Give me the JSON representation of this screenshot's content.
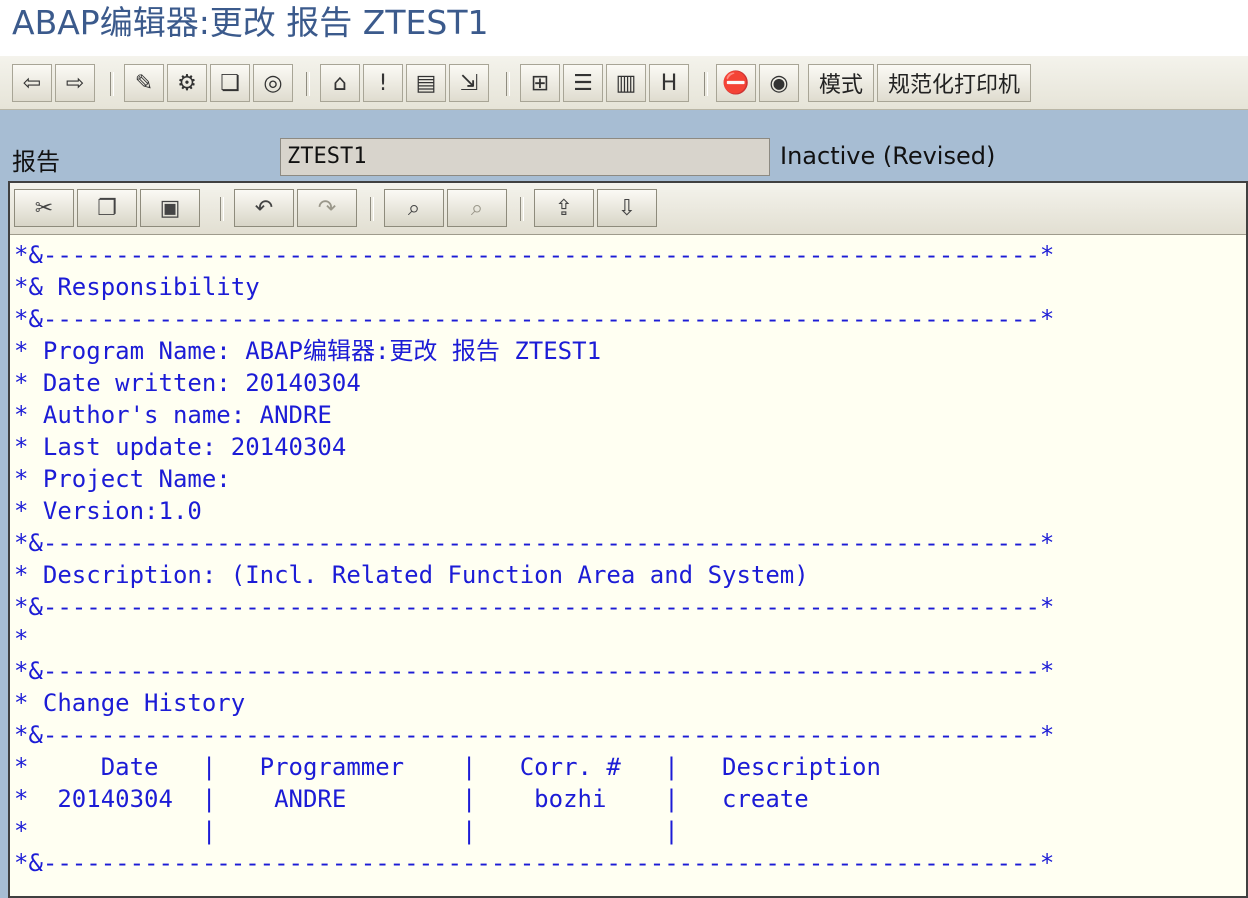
{
  "window": {
    "title": "ABAP编辑器:更改 报告 ZTEST1"
  },
  "toolbar": {
    "nav": [
      {
        "name": "back-icon",
        "glyph": "⇦"
      },
      {
        "name": "forward-icon",
        "glyph": "⇨"
      }
    ],
    "group1": [
      {
        "name": "display-change-icon",
        "glyph": "✎"
      },
      {
        "name": "active-inactive-icon",
        "glyph": "⚙"
      },
      {
        "name": "other-object-icon",
        "glyph": "❏"
      },
      {
        "name": "check-icon",
        "glyph": "◎"
      }
    ],
    "group2": [
      {
        "name": "activate-icon",
        "glyph": "⌂"
      },
      {
        "name": "test-icon",
        "glyph": "!"
      },
      {
        "name": "where-used-icon",
        "glyph": "▤"
      },
      {
        "name": "navigation-icon",
        "glyph": "⇲"
      }
    ],
    "group3": [
      {
        "name": "object-list-icon",
        "glyph": "⊞"
      },
      {
        "name": "stack-icon",
        "glyph": "☰"
      },
      {
        "name": "display-object-icon",
        "glyph": "▥"
      },
      {
        "name": "info-icon",
        "glyph": "H"
      }
    ],
    "group4": [
      {
        "name": "stop-icon",
        "glyph": "⛔"
      },
      {
        "name": "breakpoint-icon",
        "glyph": "◉"
      }
    ],
    "mode_label": "模式",
    "pretty_printer_label": "规范化打印机"
  },
  "report": {
    "label": "报告",
    "name": "ZTEST1",
    "status": "Inactive (Revised)"
  },
  "editor_toolbar": [
    {
      "name": "cut-icon",
      "glyph": "✂",
      "dim": false
    },
    {
      "name": "copy-icon",
      "glyph": "❐",
      "dim": false
    },
    {
      "name": "paste-icon",
      "glyph": "▣",
      "dim": false
    },
    {
      "name": "undo-icon",
      "glyph": "↶",
      "dim": false
    },
    {
      "name": "redo-icon",
      "glyph": "↷",
      "dim": true
    },
    {
      "name": "find-icon",
      "glyph": "⌕",
      "dim": false
    },
    {
      "name": "find-next-icon",
      "glyph": "⌕",
      "dim": true
    },
    {
      "name": "upload-icon",
      "glyph": "⇪",
      "dim": false
    },
    {
      "name": "download-icon",
      "glyph": "⇩",
      "dim": false
    }
  ],
  "code_lines": [
    "*&---------------------------------------------------------------------*",
    "*& Responsibility",
    "*&---------------------------------------------------------------------*",
    "* Program Name: ABAP编辑器:更改 报告 ZTEST1",
    "* Date written: 20140304",
    "* Author's name: ANDRE",
    "* Last update: 20140304",
    "* Project Name:",
    "* Version:1.0",
    "*&---------------------------------------------------------------------*",
    "* Description: (Incl. Related Function Area and System)",
    "*&---------------------------------------------------------------------*",
    "*",
    "*&---------------------------------------------------------------------*",
    "* Change History",
    "*&---------------------------------------------------------------------*",
    "*     Date   |   Programmer    |   Corr. #   |   Description",
    "*  20140304  |    ANDRE        |    bozhi    |   create",
    "*            |                 |             |",
    "*&---------------------------------------------------------------------*"
  ],
  "colors": {
    "title": "#3b5a8c",
    "code": "#1c1cd6",
    "editor_bg": "#fffff2",
    "panel_bg": "#a7bdd3"
  }
}
